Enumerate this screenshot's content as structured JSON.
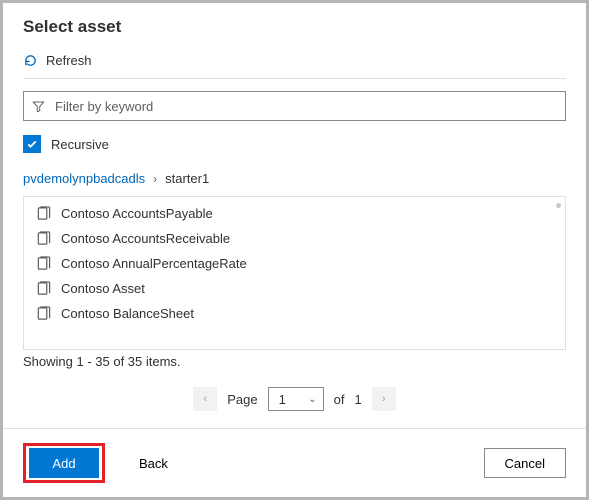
{
  "title": "Select asset",
  "refresh_label": "Refresh",
  "filter": {
    "placeholder": "Filter by keyword",
    "value": ""
  },
  "recursive": {
    "label": "Recursive",
    "checked": true
  },
  "breadcrumb": {
    "root": "pvdemolynpbadcadls",
    "current": "starter1"
  },
  "assets": [
    {
      "label": "Contoso AccountsPayable"
    },
    {
      "label": "Contoso AccountsReceivable"
    },
    {
      "label": "Contoso AnnualPercentageRate"
    },
    {
      "label": "Contoso Asset"
    },
    {
      "label": "Contoso BalanceSheet"
    }
  ],
  "showing_text": "Showing 1 - 35 of 35 items.",
  "pager": {
    "page_label": "Page",
    "current": "1",
    "of_label": "of",
    "total": "1"
  },
  "buttons": {
    "add": "Add",
    "back": "Back",
    "cancel": "Cancel"
  },
  "icons": {
    "refresh": "refresh-icon",
    "funnel": "funnel-icon",
    "asset": "asset-file-icon",
    "chevron_down": "chevron-down-icon",
    "prev": "chevron-left-icon",
    "next": "chevron-right-icon"
  }
}
